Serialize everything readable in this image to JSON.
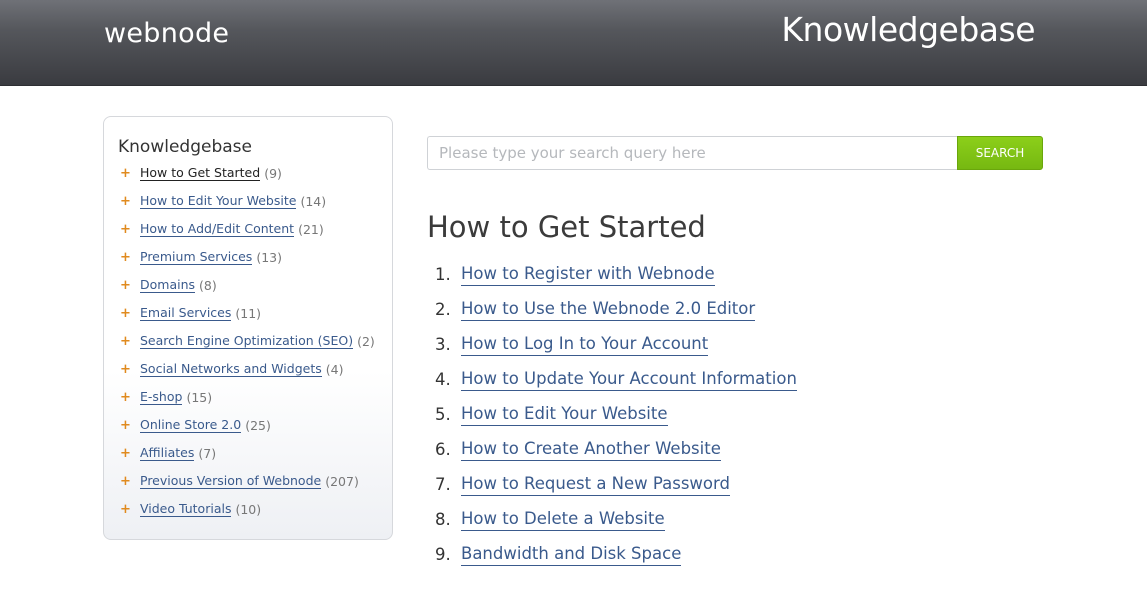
{
  "header": {
    "logo": "webnode",
    "title": "Knowledgebase"
  },
  "sidebar": {
    "title": "Knowledgebase",
    "items": [
      {
        "label": "How to Get Started",
        "count": "(9)"
      },
      {
        "label": "How to Edit Your Website",
        "count": "(14)"
      },
      {
        "label": "How to Add/Edit Content",
        "count": "(21)"
      },
      {
        "label": "Premium Services",
        "count": "(13)"
      },
      {
        "label": "Domains",
        "count": "(8)"
      },
      {
        "label": "Email Services",
        "count": "(11)"
      },
      {
        "label": "Search Engine Optimization (SEO)",
        "count": "(2)"
      },
      {
        "label": "Social Networks and Widgets",
        "count": "(4)"
      },
      {
        "label": "E-shop",
        "count": "(15)"
      },
      {
        "label": "Online Store 2.0",
        "count": "(25)"
      },
      {
        "label": "Affiliates",
        "count": "(7)"
      },
      {
        "label": "Previous Version of Webnode",
        "count": "(207)"
      },
      {
        "label": "Video Tutorials",
        "count": "(10)"
      }
    ]
  },
  "search": {
    "placeholder": "Please type your search query here",
    "value": "",
    "button_label": "SEARCH"
  },
  "main": {
    "title": "How to Get Started",
    "articles": [
      {
        "num": "1.",
        "label": "How to Register with Webnode"
      },
      {
        "num": "2.",
        "label": "How to Use the Webnode 2.0 Editor"
      },
      {
        "num": "3.",
        "label": "How to Log In to Your Account"
      },
      {
        "num": "4.",
        "label": "How to Update Your Account Information"
      },
      {
        "num": "5.",
        "label": "How to Edit Your Website"
      },
      {
        "num": "6.",
        "label": "How to Create Another Website"
      },
      {
        "num": "7.",
        "label": "How to Request a New Password"
      },
      {
        "num": "8.",
        "label": "How to Delete a Website"
      },
      {
        "num": "9.",
        "label": "Bandwidth and Disk Space"
      }
    ]
  },
  "colors": {
    "accent_green": "#7ec21a",
    "link_blue": "#3a5a8c",
    "plus_orange": "#e08a1e",
    "header_dark": "#3a3b40"
  }
}
